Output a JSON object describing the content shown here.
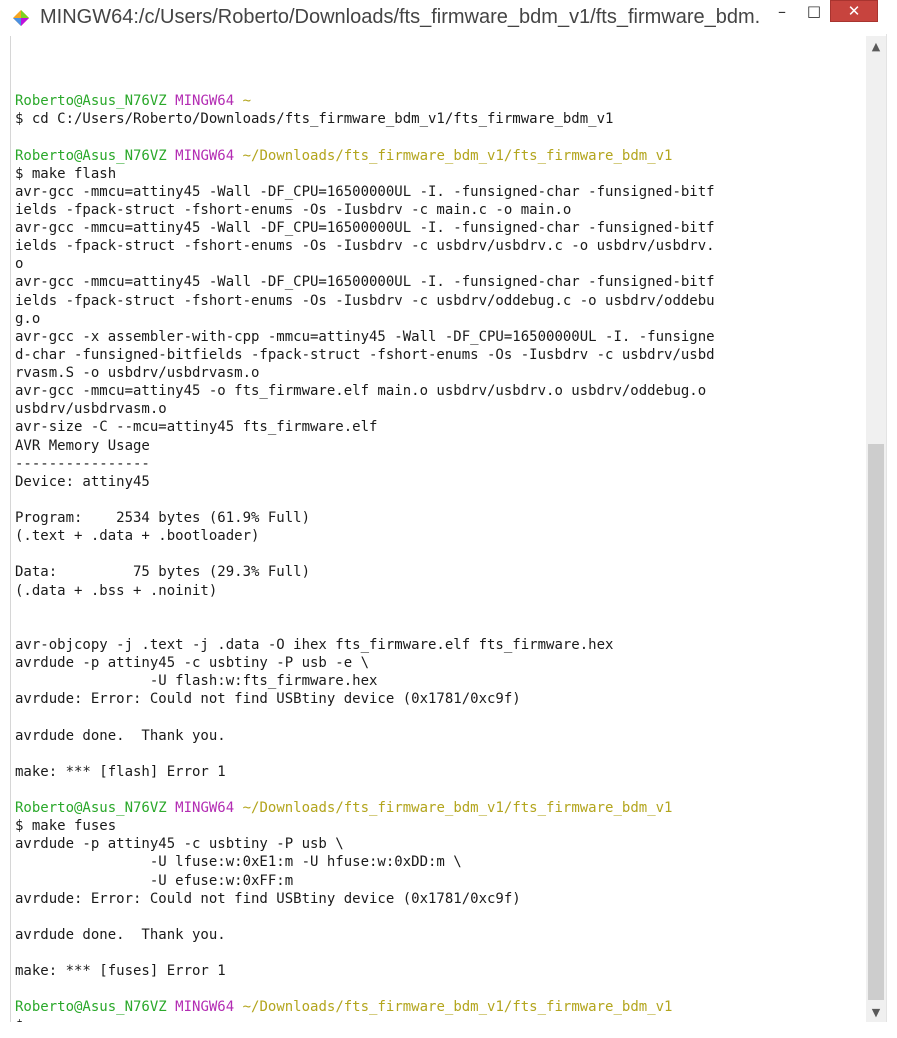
{
  "window": {
    "title": "MINGW64:/c/Users/Roberto/Downloads/fts_firmware_bdm_v1/fts_firmware_bdm...",
    "icon": "mintty-diamond-icon",
    "buttons": {
      "minimize": "–",
      "maximize": "□",
      "close": "✕"
    }
  },
  "colors": {
    "prompt_user": "#2aa82a",
    "prompt_system": "#b32cb3",
    "prompt_path": "#b3a51d",
    "text": "#1a1a1a",
    "close_button": "#c7443e"
  },
  "terminal": {
    "lines": [
      {
        "type": "blank"
      },
      {
        "type": "prompt",
        "user": "Roberto@Asus_N76VZ",
        "system": "MINGW64",
        "path": "~"
      },
      {
        "type": "text",
        "text": "$ cd C:/Users/Roberto/Downloads/fts_firmware_bdm_v1/fts_firmware_bdm_v1"
      },
      {
        "type": "blank"
      },
      {
        "type": "prompt",
        "user": "Roberto@Asus_N76VZ",
        "system": "MINGW64",
        "path": "~/Downloads/fts_firmware_bdm_v1/fts_firmware_bdm_v1"
      },
      {
        "type": "text",
        "text": "$ make flash"
      },
      {
        "type": "text",
        "text": "avr-gcc -mmcu=attiny45 -Wall -DF_CPU=16500000UL -I. -funsigned-char -funsigned-bitf"
      },
      {
        "type": "text",
        "text": "ields -fpack-struct -fshort-enums -Os -Iusbdrv -c main.c -o main.o"
      },
      {
        "type": "text",
        "text": "avr-gcc -mmcu=attiny45 -Wall -DF_CPU=16500000UL -I. -funsigned-char -funsigned-bitf"
      },
      {
        "type": "text",
        "text": "ields -fpack-struct -fshort-enums -Os -Iusbdrv -c usbdrv/usbdrv.c -o usbdrv/usbdrv."
      },
      {
        "type": "text",
        "text": "o"
      },
      {
        "type": "text",
        "text": "avr-gcc -mmcu=attiny45 -Wall -DF_CPU=16500000UL -I. -funsigned-char -funsigned-bitf"
      },
      {
        "type": "text",
        "text": "ields -fpack-struct -fshort-enums -Os -Iusbdrv -c usbdrv/oddebug.c -o usbdrv/oddebu"
      },
      {
        "type": "text",
        "text": "g.o"
      },
      {
        "type": "text",
        "text": "avr-gcc -x assembler-with-cpp -mmcu=attiny45 -Wall -DF_CPU=16500000UL -I. -funsigne"
      },
      {
        "type": "text",
        "text": "d-char -funsigned-bitfields -fpack-struct -fshort-enums -Os -Iusbdrv -c usbdrv/usbd"
      },
      {
        "type": "text",
        "text": "rvasm.S -o usbdrv/usbdrvasm.o"
      },
      {
        "type": "text",
        "text": "avr-gcc -mmcu=attiny45 -o fts_firmware.elf main.o usbdrv/usbdrv.o usbdrv/oddebug.o"
      },
      {
        "type": "text",
        "text": "usbdrv/usbdrvasm.o"
      },
      {
        "type": "text",
        "text": "avr-size -C --mcu=attiny45 fts_firmware.elf"
      },
      {
        "type": "text",
        "text": "AVR Memory Usage"
      },
      {
        "type": "text",
        "text": "----------------"
      },
      {
        "type": "text",
        "text": "Device: attiny45"
      },
      {
        "type": "blank"
      },
      {
        "type": "text",
        "text": "Program:    2534 bytes (61.9% Full)"
      },
      {
        "type": "text",
        "text": "(.text + .data + .bootloader)"
      },
      {
        "type": "blank"
      },
      {
        "type": "text",
        "text": "Data:         75 bytes (29.3% Full)"
      },
      {
        "type": "text",
        "text": "(.data + .bss + .noinit)"
      },
      {
        "type": "blank"
      },
      {
        "type": "blank"
      },
      {
        "type": "text",
        "text": "avr-objcopy -j .text -j .data -O ihex fts_firmware.elf fts_firmware.hex"
      },
      {
        "type": "text",
        "text": "avrdude -p attiny45 -c usbtiny -P usb -e \\"
      },
      {
        "type": "text",
        "text": "                -U flash:w:fts_firmware.hex"
      },
      {
        "type": "text",
        "text": "avrdude: Error: Could not find USBtiny device (0x1781/0xc9f)"
      },
      {
        "type": "blank"
      },
      {
        "type": "text",
        "text": "avrdude done.  Thank you."
      },
      {
        "type": "blank"
      },
      {
        "type": "text",
        "text": "make: *** [flash] Error 1"
      },
      {
        "type": "blank"
      },
      {
        "type": "prompt",
        "user": "Roberto@Asus_N76VZ",
        "system": "MINGW64",
        "path": "~/Downloads/fts_firmware_bdm_v1/fts_firmware_bdm_v1"
      },
      {
        "type": "text",
        "text": "$ make fuses"
      },
      {
        "type": "text",
        "text": "avrdude -p attiny45 -c usbtiny -P usb \\"
      },
      {
        "type": "text",
        "text": "                -U lfuse:w:0xE1:m -U hfuse:w:0xDD:m \\"
      },
      {
        "type": "text",
        "text": "                -U efuse:w:0xFF:m"
      },
      {
        "type": "text",
        "text": "avrdude: Error: Could not find USBtiny device (0x1781/0xc9f)"
      },
      {
        "type": "blank"
      },
      {
        "type": "text",
        "text": "avrdude done.  Thank you."
      },
      {
        "type": "blank"
      },
      {
        "type": "text",
        "text": "make: *** [fuses] Error 1"
      },
      {
        "type": "blank"
      },
      {
        "type": "prompt",
        "user": "Roberto@Asus_N76VZ",
        "system": "MINGW64",
        "path": "~/Downloads/fts_firmware_bdm_v1/fts_firmware_bdm_v1"
      },
      {
        "type": "text",
        "text": "$"
      }
    ]
  },
  "scrollbar": {
    "up_icon": "▲",
    "down_icon": "▼"
  }
}
